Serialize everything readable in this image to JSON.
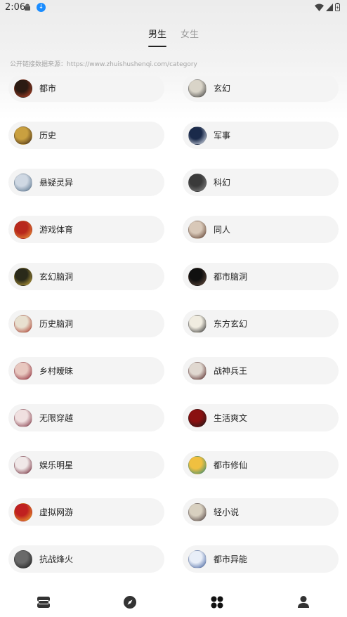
{
  "status_bar": {
    "time": "2:06"
  },
  "tabs": [
    {
      "label": "男生",
      "active": true
    },
    {
      "label": "女生",
      "active": false
    }
  ],
  "source_note": "公开链接数据来源：https://www.zhuishushenqi.com/category",
  "categories": [
    {
      "label": "都市",
      "thumb_colors": [
        "#2b1a12",
        "#c4482a"
      ]
    },
    {
      "label": "玄幻",
      "thumb_colors": [
        "#d9d4c8",
        "#3a3a3a"
      ]
    },
    {
      "label": "历史",
      "thumb_colors": [
        "#c9a040",
        "#3b2410"
      ]
    },
    {
      "label": "军事",
      "thumb_colors": [
        "#1a2a4a",
        "#e8eef8"
      ]
    },
    {
      "label": "悬疑灵异",
      "thumb_colors": [
        "#cfd8e3",
        "#4f6b86"
      ]
    },
    {
      "label": "科幻",
      "thumb_colors": [
        "#3a3a3a",
        "#8a8a8a"
      ]
    },
    {
      "label": "游戏体育",
      "thumb_colors": [
        "#b8281c",
        "#f0a040"
      ]
    },
    {
      "label": "同人",
      "thumb_colors": [
        "#d8c8b8",
        "#5a3a2a"
      ]
    },
    {
      "label": "玄幻脑洞",
      "thumb_colors": [
        "#2a2a1a",
        "#d0b040"
      ]
    },
    {
      "label": "都市脑洞",
      "thumb_colors": [
        "#101010",
        "#6a5040"
      ]
    },
    {
      "label": "历史脑洞",
      "thumb_colors": [
        "#e8e0d0",
        "#a83020"
      ]
    },
    {
      "label": "东方玄幻",
      "thumb_colors": [
        "#f0ece0",
        "#2a2a2a"
      ]
    },
    {
      "label": "乡村暧昧",
      "thumb_colors": [
        "#e8c8c0",
        "#8a2030"
      ]
    },
    {
      "label": "战神兵王",
      "thumb_colors": [
        "#e0d8d0",
        "#502020"
      ]
    },
    {
      "label": "无限穿越",
      "thumb_colors": [
        "#f0e0e0",
        "#7a2a3a"
      ]
    },
    {
      "label": "生活爽文",
      "thumb_colors": [
        "#8a1010",
        "#1a1a1a"
      ]
    },
    {
      "label": "娱乐明星",
      "thumb_colors": [
        "#f0e8e8",
        "#6a1a2a"
      ]
    },
    {
      "label": "都市修仙",
      "thumb_colors": [
        "#f0c040",
        "#2a8a7a"
      ]
    },
    {
      "label": "虚拟网游",
      "thumb_colors": [
        "#c02020",
        "#f0b030"
      ]
    },
    {
      "label": "轻小说",
      "thumb_colors": [
        "#d8d0c0",
        "#4a3a3a"
      ]
    },
    {
      "label": "抗战烽火",
      "thumb_colors": [
        "#6a6a6a",
        "#1a1a1a"
      ]
    },
    {
      "label": "都市异能",
      "thumb_colors": [
        "#e8eef8",
        "#3a5a9a"
      ]
    }
  ],
  "bottom_nav": [
    {
      "icon": "bookshelf-icon",
      "active": false
    },
    {
      "icon": "compass-icon",
      "active": false
    },
    {
      "icon": "category-icon",
      "active": true
    },
    {
      "icon": "profile-icon",
      "active": false
    }
  ],
  "colors": {
    "accent": "#222222",
    "inactive": "#9a9a9a",
    "chip_bg": "#f4f4f4"
  }
}
